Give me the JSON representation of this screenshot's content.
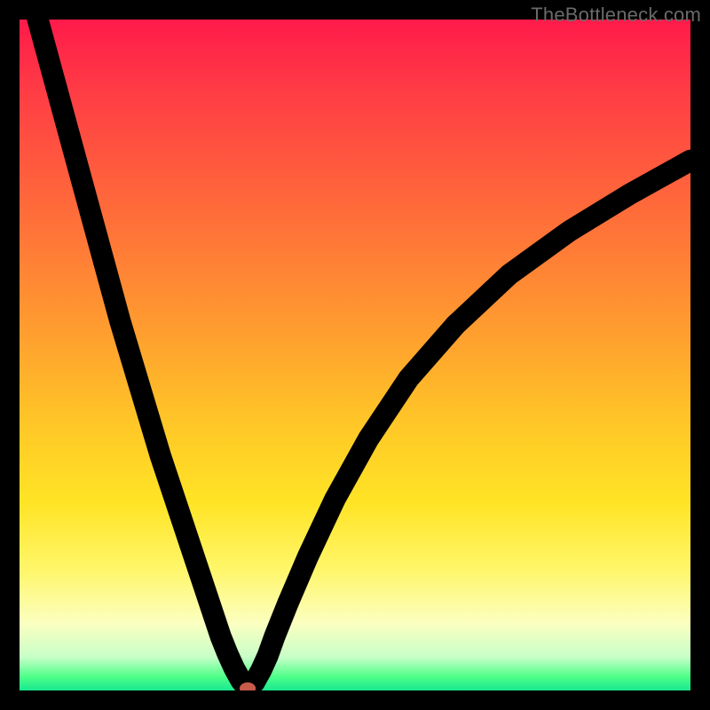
{
  "watermark": "TheBottleneck.com",
  "chart_data": {
    "type": "line",
    "title": "",
    "xlabel": "",
    "ylabel": "",
    "xlim": [
      0,
      100
    ],
    "ylim": [
      0,
      100
    ],
    "grid": false,
    "legend": false,
    "marker": {
      "x": 34,
      "y": 0.3
    },
    "series": [
      {
        "name": "bottleneck-curve",
        "x": [
          0,
          3,
          6,
          9,
          12,
          15,
          18,
          21,
          24,
          27,
          30,
          31,
          32,
          33,
          34,
          35,
          36,
          37,
          38,
          40,
          43,
          47,
          52,
          58,
          65,
          73,
          82,
          91,
          100
        ],
        "y": [
          110,
          99,
          88,
          77,
          66,
          55,
          45,
          35,
          26,
          17,
          8,
          5.5,
          3.3,
          1.5,
          0.3,
          1.2,
          3.0,
          5.2,
          8.0,
          13.0,
          20.0,
          28.5,
          37.5,
          46.5,
          54.5,
          62.0,
          68.5,
          74.0,
          79.0
        ]
      }
    ],
    "background_gradient": {
      "direction": "vertical",
      "stops": [
        {
          "pos": 0.0,
          "color": "#ff1a4a"
        },
        {
          "pos": 0.22,
          "color": "#ff5a3e"
        },
        {
          "pos": 0.48,
          "color": "#ffa22e"
        },
        {
          "pos": 0.72,
          "color": "#ffe425"
        },
        {
          "pos": 0.9,
          "color": "#fbffc0"
        },
        {
          "pos": 1.0,
          "color": "#18e890"
        }
      ]
    }
  }
}
